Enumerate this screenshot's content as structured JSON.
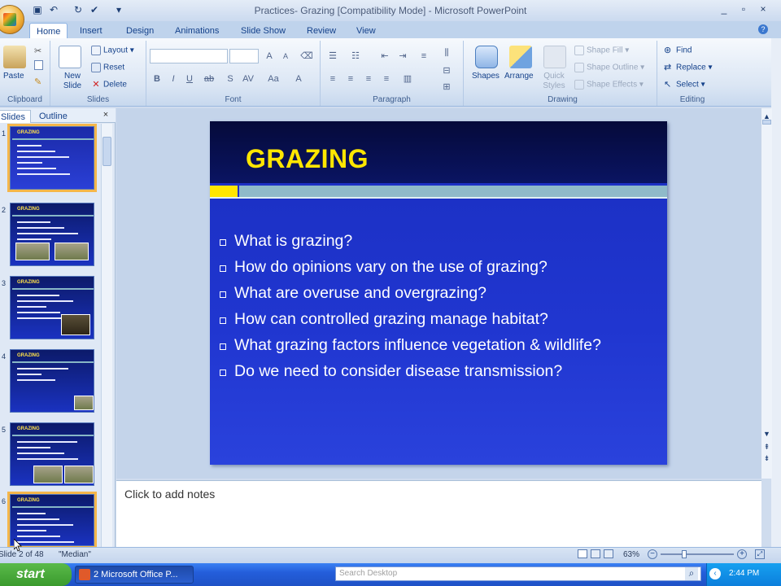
{
  "window": {
    "title": "Practices- Grazing [Compatibility Mode] - Microsoft PowerPoint",
    "controls": [
      "_",
      "▫",
      "×"
    ]
  },
  "qat": [
    "save-icon",
    "undo-icon",
    "redo-icon",
    "spelling-icon",
    "customize-icon"
  ],
  "tabs": [
    "Home",
    "Insert",
    "Design",
    "Animations",
    "Slide Show",
    "Review",
    "View"
  ],
  "ribbon": {
    "clipboard": {
      "paste": "Paste",
      "label": "Clipboard"
    },
    "slides": {
      "new_slide": "New Slide",
      "layout": "Layout",
      "reset": "Reset",
      "delete": "Delete",
      "label": "Slides"
    },
    "font": {
      "label": "Font",
      "font_name": "",
      "font_size": ""
    },
    "paragraph": {
      "label": "Paragraph"
    },
    "drawing": {
      "shapes": "Shapes",
      "arrange": "Arrange",
      "quick_styles": "Quick Styles",
      "shape_fill": "Shape Fill",
      "shape_outline": "Shape Outline",
      "shape_effects": "Shape Effects",
      "label": "Drawing"
    },
    "editing": {
      "find": "Find",
      "replace": "Replace",
      "select": "Select",
      "label": "Editing"
    }
  },
  "pane": {
    "tab_slides": "Slides",
    "tab_outline": "Outline",
    "close": "×"
  },
  "thumbnails": [
    {
      "num": "1",
      "title": "GRAZING"
    },
    {
      "num": "2",
      "title": "GRAZING"
    },
    {
      "num": "3",
      "title": "GRAZING"
    },
    {
      "num": "4",
      "title": "GRAZING"
    },
    {
      "num": "5",
      "title": "GRAZING"
    },
    {
      "num": "6",
      "title": "GRAZING"
    }
  ],
  "slide": {
    "title": "GRAZING",
    "bullets": [
      "What is grazing?",
      "How do opinions vary on the use of grazing?",
      "What are overuse and overgrazing?",
      "How can controlled grazing manage habitat?",
      "What grazing factors influence vegetation & wildlife?",
      "Do we need to consider disease transmission?"
    ],
    "title_color": "#ffe600",
    "background_color": "#2036d0"
  },
  "notes": {
    "placeholder": "Click to add notes"
  },
  "status": {
    "slide_info": "Slide 2 of 48",
    "theme": "\"Median\"",
    "zoom": "63%"
  },
  "taskbar": {
    "start": "start",
    "task_item": "2 Microsoft Office P...",
    "search_placeholder": "Search Desktop",
    "clock": "2:44 PM"
  }
}
